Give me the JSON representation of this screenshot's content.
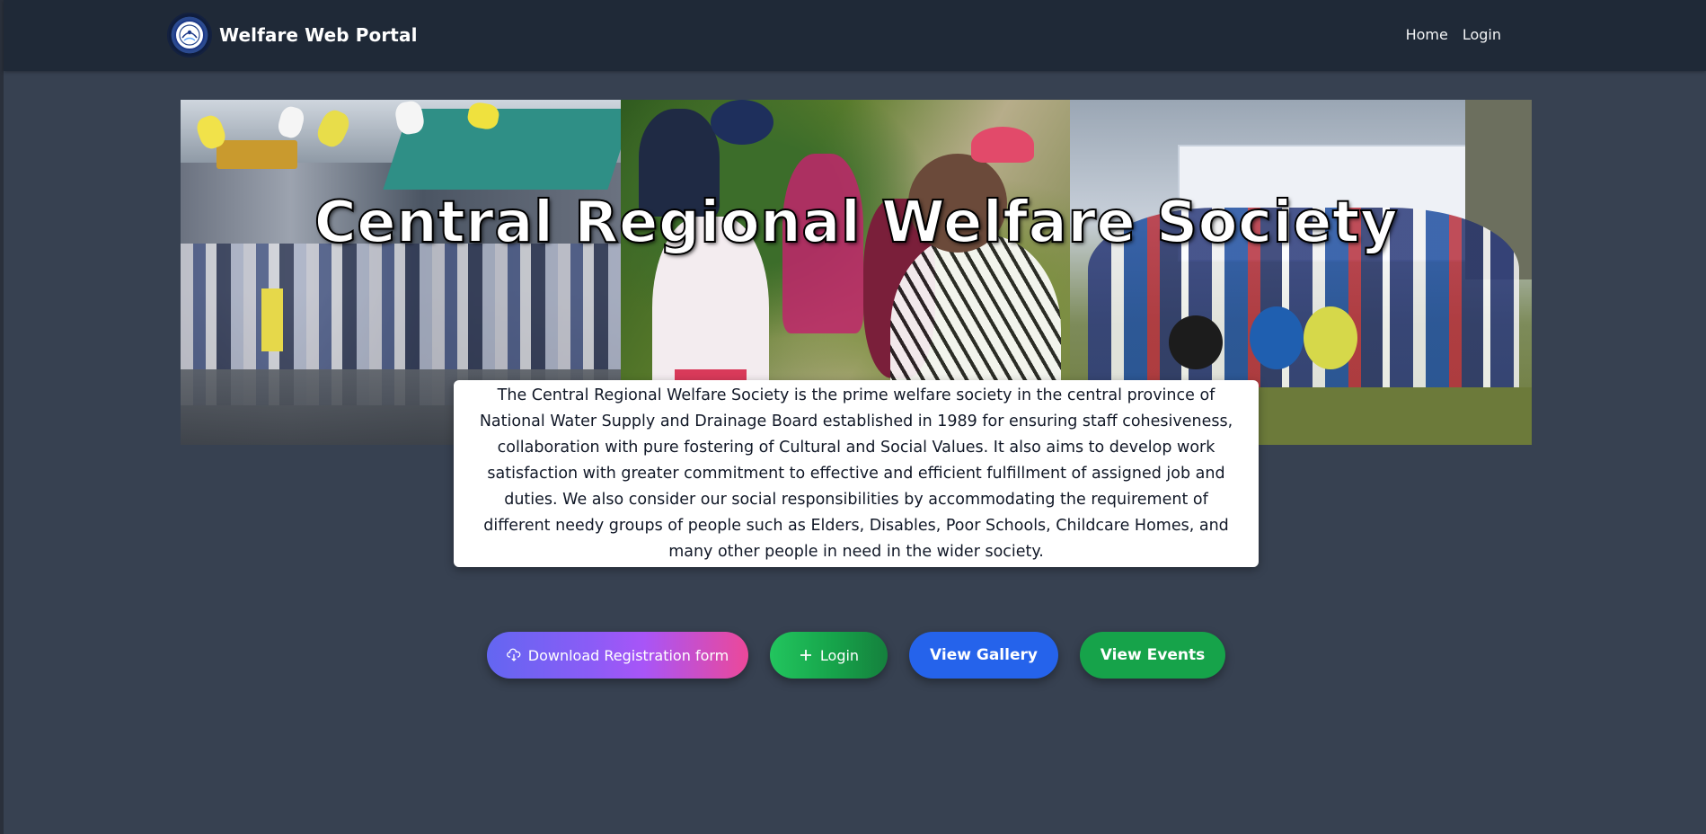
{
  "navbar": {
    "brand_name": "Welfare Web Portal",
    "logo_icon": "welfare-society-emblem",
    "links": [
      {
        "label": "Home"
      },
      {
        "label": "Login"
      }
    ]
  },
  "hero": {
    "title": "Central Regional Welfare Society",
    "photos": [
      "boc-smart-crowd-photo",
      "tug-of-war-photo",
      "team-group-photo"
    ]
  },
  "about": {
    "text": "The Central Regional Welfare Society is the prime welfare society in the central province of National Water Supply and Drainage Board established in 1989 for ensuring staff cohesiveness, collaboration with pure fostering of Cultural and Social Values. It also aims to develop work satisfaction with greater commitment to effective and efficient fulfillment of assigned job and duties. We also consider our social responsibilities by accommodating the requirement of different needy groups of people such as Elders, Disables, Poor Schools, Childcare Homes, and many other people in need in the wider society."
  },
  "actions": {
    "download_label": "Download Registration form",
    "download_icon": "download-cloud-icon",
    "login_label": "Login",
    "login_icon": "plus-icon",
    "gallery_label": "View Gallery",
    "events_label": "View Events"
  },
  "colors": {
    "page_bg": "#374151",
    "navbar_bg": "#1f2937",
    "gallery_blue": "#2563eb",
    "events_green": "#16a34a",
    "download_gradient_start": "#6366f1",
    "download_gradient_end": "#ec4899"
  }
}
